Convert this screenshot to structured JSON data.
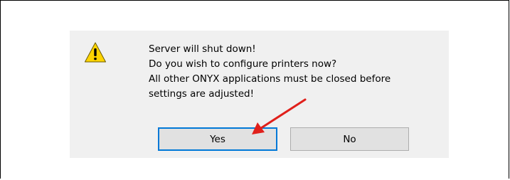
{
  "dialog": {
    "message_lines": [
      "Server will shut down!",
      "Do you wish to configure printers now?",
      "All other ONYX applications must be closed before",
      "settings are adjusted!"
    ],
    "icon": "warning-icon",
    "buttons": {
      "yes_label": "Yes",
      "no_label": "No"
    }
  },
  "annotation": {
    "type": "arrow",
    "color": "#e0201b",
    "points_to": "yes-button"
  },
  "colors": {
    "dialog_background": "#f0f0f0",
    "focus_border": "#0078d7",
    "button_background": "#e1e1e1",
    "warning_yellow": "#ffd400"
  }
}
